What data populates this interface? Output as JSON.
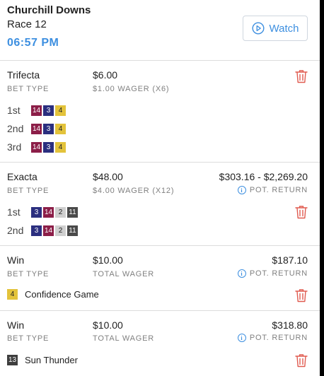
{
  "header": {
    "track": "Churchill Downs",
    "race": "Race 12",
    "post_time": "06:57 PM",
    "watch_label": "Watch"
  },
  "colors": {
    "accent": "#3d8fe0",
    "delete": "#e05a4f",
    "saddle_14": "#8c1e48",
    "saddle_3": "#2b2f7f",
    "saddle_4": "#e3c33b",
    "saddle_2": "#cfcfcf",
    "saddle_11": "#4a4a4a",
    "saddle_13": "#3e3e3e"
  },
  "icons": [
    "play-circle-icon",
    "trash-icon",
    "info-icon"
  ],
  "bets": [
    {
      "type": "Trifecta",
      "type_label": "BET TYPE",
      "amount": "$6.00",
      "wager_label": "$1.00 WAGER (X6)",
      "positions": [
        {
          "label": "1st",
          "horses": [
            "14",
            "3",
            "4"
          ]
        },
        {
          "label": "2nd",
          "horses": [
            "14",
            "3",
            "4"
          ]
        },
        {
          "label": "3rd",
          "horses": [
            "14",
            "3",
            "4"
          ]
        }
      ]
    },
    {
      "type": "Exacta",
      "type_label": "BET TYPE",
      "amount": "$48.00",
      "wager_label": "$4.00 WAGER (X12)",
      "return_value": "$303.16 - $2,269.20",
      "return_label": "POT. RETURN",
      "positions": [
        {
          "label": "1st",
          "horses": [
            "3",
            "14",
            "2",
            "11"
          ]
        },
        {
          "label": "2nd",
          "horses": [
            "3",
            "14",
            "2",
            "11"
          ]
        }
      ]
    },
    {
      "type": "Win",
      "type_label": "BET TYPE",
      "amount": "$10.00",
      "wager_label": "TOTAL WAGER",
      "return_value": "$187.10",
      "return_label": "POT. RETURN",
      "runner_number": "4",
      "runner_name": "Confidence Game"
    },
    {
      "type": "Win",
      "type_label": "BET TYPE",
      "amount": "$10.00",
      "wager_label": "TOTAL WAGER",
      "return_value": "$318.80",
      "return_label": "POT. RETURN",
      "runner_number": "13",
      "runner_name": "Sun Thunder"
    }
  ]
}
